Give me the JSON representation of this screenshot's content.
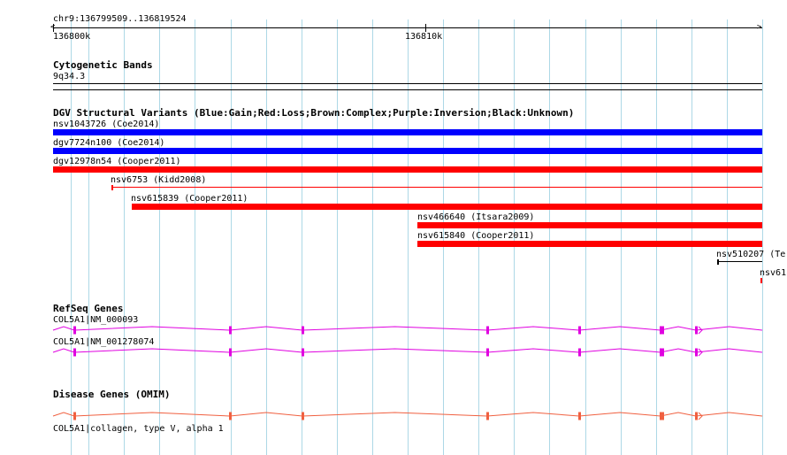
{
  "ruler": {
    "range": "chr9:136799509..136819524",
    "ticks": [
      {
        "label": "136800k"
      },
      {
        "label": "136810k"
      }
    ]
  },
  "cytoband": {
    "title": "Cytogenetic Bands",
    "band": "9q34.3"
  },
  "dgv": {
    "title": "DGV Structural Variants (Blue:Gain;Red:Loss;Brown:Complex;Purple:Inversion;Black:Unknown)",
    "variants": [
      {
        "label": "nsv1043726 (Coe2014)",
        "color": "#0000ff"
      },
      {
        "label": "dgv7724n100 (Coe2014)",
        "color": "#0000ff"
      },
      {
        "label": "dgv12978n54 (Cooper2011)",
        "color": "#ff0000"
      },
      {
        "label": "nsv6753 (Kidd2008)",
        "color": "#ff0000"
      },
      {
        "label": "nsv615839 (Cooper2011)",
        "color": "#ff0000"
      },
      {
        "label": "nsv466640 (Itsara2009)",
        "color": "#ff0000"
      },
      {
        "label": "nsv615840 (Cooper2011)",
        "color": "#ff0000"
      },
      {
        "label": "nsv510207 (Te",
        "color": "#000000"
      },
      {
        "label": "nsv61",
        "color": "#ff0000"
      }
    ]
  },
  "refseq": {
    "title": "RefSeq Genes",
    "color": "#e000e0",
    "genes": [
      {
        "label": "COL5A1|NM_000093"
      },
      {
        "label": "COL5A1|NM_001278074"
      }
    ]
  },
  "omim": {
    "title": "Disease Genes (OMIM)",
    "color": "#f06040",
    "genes": [
      {
        "label": "COL5A1|collagen, type V, alpha 1"
      }
    ]
  }
}
